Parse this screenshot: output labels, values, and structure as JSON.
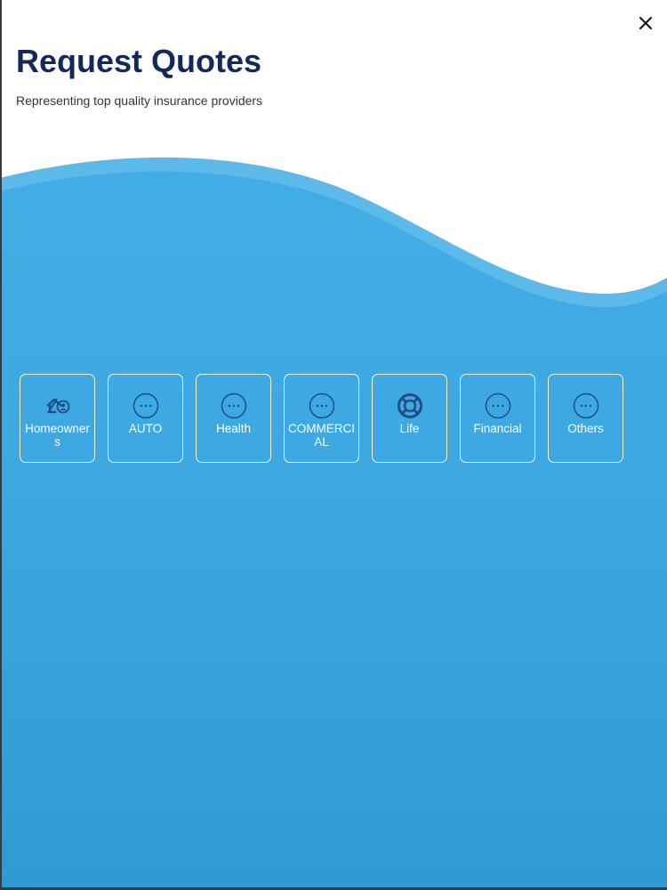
{
  "header": {
    "title": "Request Quotes",
    "subtitle": "Representing top quality insurance providers"
  },
  "close": {
    "icon": "close-icon"
  },
  "theme": {
    "title_color": "#13295b",
    "wave_light": "#5cb8ea",
    "wave_main": "#3da8e2",
    "wave_deep": "#2f97d3",
    "icon_color": "#1f4e85"
  },
  "categories": [
    {
      "label": "Homeowners",
      "icon": "house-user-icon"
    },
    {
      "label": "AUTO",
      "icon": "more-horizontal-icon"
    },
    {
      "label": "Health",
      "icon": "more-horizontal-icon"
    },
    {
      "label": "COMMERCIAL",
      "icon": "more-horizontal-icon"
    },
    {
      "label": "Life",
      "icon": "lifebuoy-icon"
    },
    {
      "label": "Financial",
      "icon": "more-horizontal-icon"
    },
    {
      "label": "Others",
      "icon": "more-horizontal-icon"
    }
  ]
}
